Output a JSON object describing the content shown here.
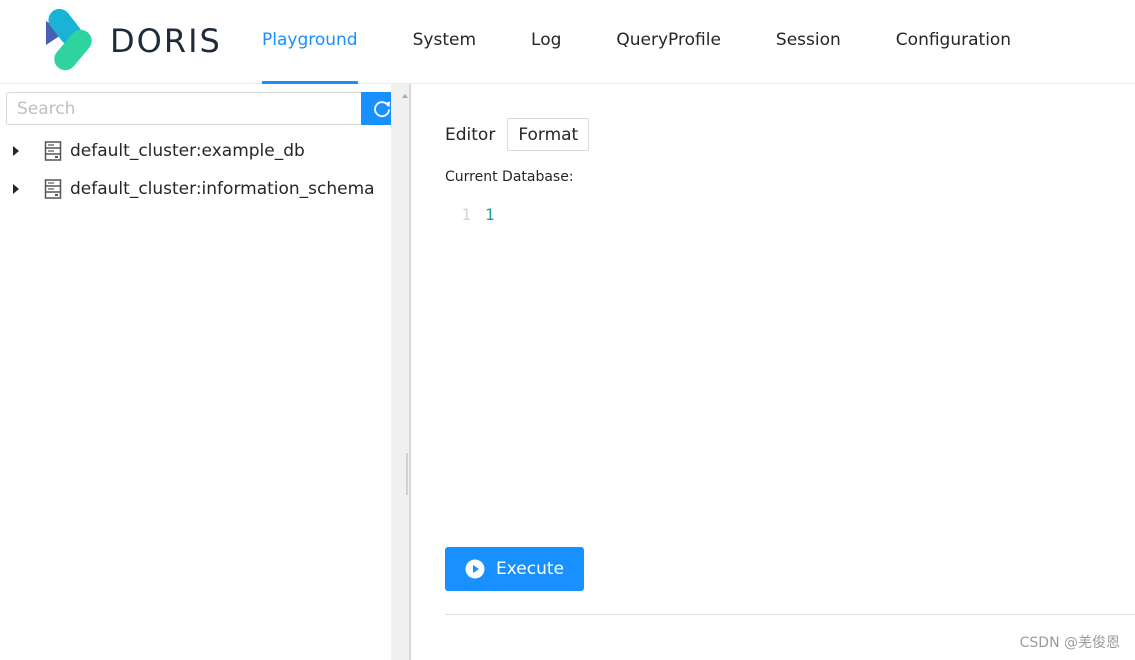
{
  "brand": {
    "name": "DORIS",
    "colors": {
      "primary": "#1890ff",
      "logo_blue": "#4b5fb0",
      "logo_cyan": "#1ab3d6",
      "logo_green": "#2ed3a0"
    }
  },
  "nav": {
    "items": [
      {
        "label": "Playground",
        "active": true
      },
      {
        "label": "System",
        "active": false
      },
      {
        "label": "Log",
        "active": false
      },
      {
        "label": "QueryProfile",
        "active": false
      },
      {
        "label": "Session",
        "active": false
      },
      {
        "label": "Configuration",
        "active": false
      }
    ]
  },
  "sidebar": {
    "search": {
      "placeholder": "Search",
      "value": "",
      "refresh_icon": "reload-icon"
    },
    "tree": [
      {
        "label": "default_cluster:example_db",
        "icon": "database-icon",
        "expanded": false
      },
      {
        "label": "default_cluster:information_schema",
        "icon": "database-icon",
        "expanded": false
      }
    ]
  },
  "main": {
    "editor_label": "Editor",
    "format_label": "Format",
    "current_database_label": "Current Database:",
    "current_database_value": "",
    "code_lines": [
      {
        "number": "1",
        "content": "1"
      }
    ],
    "execute_label": "Execute"
  },
  "watermark": "CSDN @羌俊恩"
}
